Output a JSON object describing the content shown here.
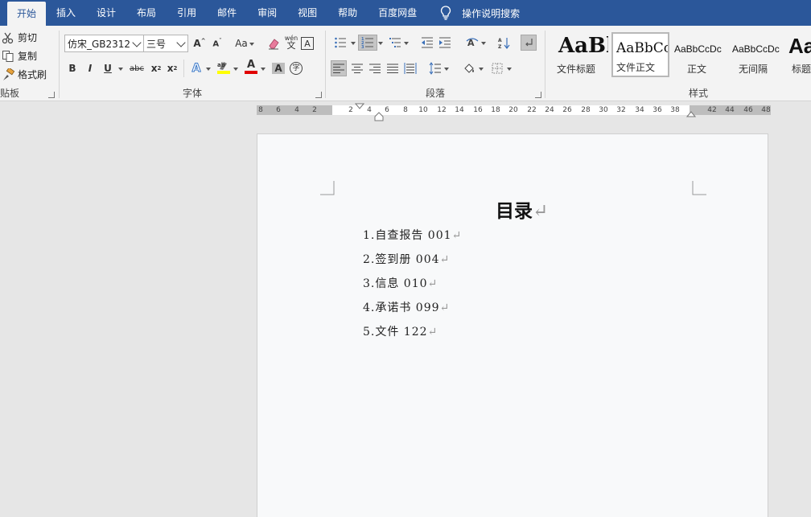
{
  "tabs": [
    {
      "label": "开始",
      "active": true
    },
    {
      "label": "插入"
    },
    {
      "label": "设计"
    },
    {
      "label": "布局"
    },
    {
      "label": "引用"
    },
    {
      "label": "邮件"
    },
    {
      "label": "审阅"
    },
    {
      "label": "视图"
    },
    {
      "label": "帮助"
    },
    {
      "label": "百度网盘"
    }
  ],
  "tell_me": "操作说明搜索",
  "clipboard": {
    "cut": "剪切",
    "copy": "复制",
    "format_painter": "格式刷",
    "group_label": "贴板"
  },
  "font": {
    "name": "仿宋_GB2312",
    "size": "三号",
    "change_case": "Aa",
    "clear_format_glyph": "wén",
    "clear_format_sub": "文",
    "border_char": "A",
    "bold": "B",
    "italic": "I",
    "underline": "U",
    "strike": "abc",
    "subscript": "x",
    "superscript": "x",
    "effects": "A",
    "font_color": "A",
    "shading": "A",
    "enclose": "字",
    "group_label": "字体"
  },
  "paragraph": {
    "group_label": "段落"
  },
  "styles": {
    "items": [
      {
        "sample": "AaBl",
        "name": "文件标题"
      },
      {
        "sample": "AaBbCc",
        "name": "文件正文",
        "selected": true
      },
      {
        "sample": "AaBbCcDc",
        "name": "正文"
      },
      {
        "sample": "AaBbCcDc",
        "name": "无间隔"
      },
      {
        "sample": "Aa",
        "name": "标题"
      }
    ],
    "group_label": "样式"
  },
  "ruler": {
    "ticks": [
      "8",
      "6",
      "4",
      "2",
      "2",
      "4",
      "6",
      "8",
      "10",
      "12",
      "14",
      "16",
      "18",
      "20",
      "22",
      "24",
      "26",
      "28",
      "30",
      "32",
      "34",
      "36",
      "38",
      "42",
      "44",
      "46",
      "48"
    ]
  },
  "document": {
    "title": "目录",
    "lines": [
      "1.自查报告 001",
      "2.签到册 004",
      "3.信息 010",
      "4.承诺书 099",
      "5.文件 122"
    ]
  },
  "colors": {
    "tab_bar": "#2b579a",
    "ribbon": "#f3f3f3",
    "highlight_yellow": "#ffff00",
    "font_red": "#e00000"
  }
}
